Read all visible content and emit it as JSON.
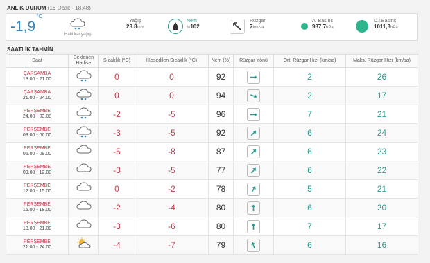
{
  "current": {
    "title": "ANLIK DURUM",
    "date": "(16 Ocak - 18.48)",
    "temp": "-1,9",
    "temp_unit": "°C",
    "condition": "Hafif kar yağışı",
    "precip_label": "Yağış",
    "precip_value": "23.8",
    "precip_unit": "mm",
    "humidity_label": "Nem",
    "humidity_prefix": "%",
    "humidity_value": "102",
    "wind_label": "Rüzgar",
    "wind_value": "7",
    "wind_unit": "km/sa",
    "pressure_label": "A. Basınç",
    "pressure_value": "937,7",
    "pressure_unit": "hPa",
    "sea_pressure_label": "D.İ.Basınç",
    "sea_pressure_value": "1011,3",
    "sea_pressure_unit": "hPa",
    "accent_color": "#2fb58e",
    "temp_color": "#3a85b5"
  },
  "hourly": {
    "title": "SAATLİK TAHMİN",
    "columns": [
      "Saat",
      "Beklenen Hadise",
      "Sıcaklık (°C)",
      "Hissedilen Sıcaklık (°C)",
      "Nem (%)",
      "Rüzgar Yönü",
      "Ort. Rüzgar Hızı (km/sa)",
      "Maks. Rüzgar Hızı (km/sa)"
    ],
    "rows": [
      {
        "day": "ÇARŞAMBA",
        "hours": "18.00 - 21.00",
        "icon": "snow-cloud-icon",
        "temp": "0",
        "feels": "0",
        "humidity": "92",
        "wind_dir": 90,
        "avg": "2",
        "max": "26"
      },
      {
        "day": "ÇARŞAMBA",
        "hours": "21.00 - 24.00",
        "icon": "snow-cloud-icon",
        "temp": "0",
        "feels": "0",
        "humidity": "94",
        "wind_dir": 110,
        "avg": "2",
        "max": "17"
      },
      {
        "day": "PERŞEMBE",
        "hours": "24.00 - 03.00",
        "icon": "snow-cloud-icon",
        "temp": "-2",
        "feels": "-5",
        "humidity": "96",
        "wind_dir": 90,
        "avg": "7",
        "max": "21"
      },
      {
        "day": "PERŞEMBE",
        "hours": "03.00 - 06.00",
        "icon": "snow-cloud-icon",
        "temp": "-3",
        "feels": "-5",
        "humidity": "92",
        "wind_dir": 45,
        "avg": "6",
        "max": "24"
      },
      {
        "day": "PERŞEMBE",
        "hours": "06.00 - 09.00",
        "icon": "cloud-icon",
        "temp": "-5",
        "feels": "-8",
        "humidity": "87",
        "wind_dir": 45,
        "avg": "6",
        "max": "23"
      },
      {
        "day": "PERŞEMBE",
        "hours": "09.00 - 12.00",
        "icon": "cloud-icon",
        "temp": "-3",
        "feels": "-5",
        "humidity": "77",
        "wind_dir": 40,
        "avg": "6",
        "max": "22"
      },
      {
        "day": "PERŞEMBE",
        "hours": "12.00 - 15.00",
        "icon": "cloud-icon",
        "temp": "0",
        "feels": "-2",
        "humidity": "78",
        "wind_dir": 30,
        "avg": "5",
        "max": "21"
      },
      {
        "day": "PERŞEMBE",
        "hours": "15.00 - 18.00",
        "icon": "cloud-icon",
        "temp": "-2",
        "feels": "-4",
        "humidity": "80",
        "wind_dir": 0,
        "avg": "6",
        "max": "20"
      },
      {
        "day": "PERŞEMBE",
        "hours": "18.00 - 21.00",
        "icon": "cloud-icon",
        "temp": "-3",
        "feels": "-6",
        "humidity": "80",
        "wind_dir": 0,
        "avg": "7",
        "max": "17"
      },
      {
        "day": "PERŞEMBE",
        "hours": "21.00 - 24.00",
        "icon": "partly-sunny-icon",
        "temp": "-4",
        "feels": "-7",
        "humidity": "79",
        "wind_dir": 340,
        "avg": "6",
        "max": "16"
      }
    ]
  }
}
